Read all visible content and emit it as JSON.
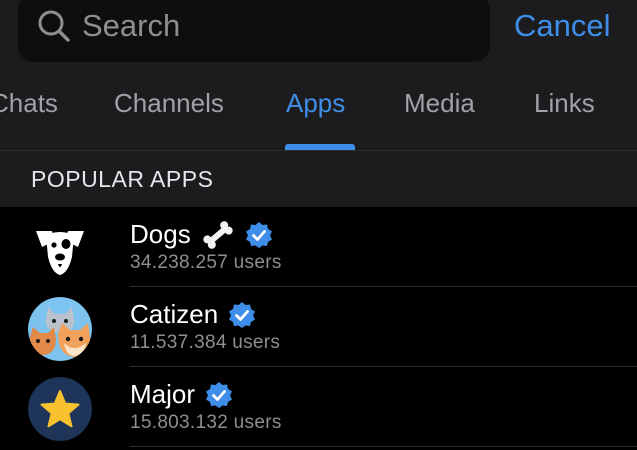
{
  "search": {
    "placeholder": "Search",
    "cancel_label": "Cancel"
  },
  "tabs": [
    {
      "label": "Chats"
    },
    {
      "label": "Channels"
    },
    {
      "label": "Apps"
    },
    {
      "label": "Media"
    },
    {
      "label": "Links"
    }
  ],
  "active_tab": "Apps",
  "section": {
    "title": "POPULAR APPS"
  },
  "apps": [
    {
      "name": "Dogs",
      "users": "34.238.257 users",
      "icon": "dog-face-icon",
      "extra_icon": "bone-icon",
      "verified": true
    },
    {
      "name": "Catizen",
      "users": "11.537.384 users",
      "icon": "cats-avatar-icon",
      "verified": true
    },
    {
      "name": "Major",
      "users": "15.803.132 users",
      "icon": "star-icon",
      "verified": true
    }
  ],
  "colors": {
    "accent": "#3e8ee9",
    "background": "#000000",
    "header_bg": "#1c1c1e",
    "secondary_text": "#8e8e93",
    "verified": "#3e8ee9"
  }
}
